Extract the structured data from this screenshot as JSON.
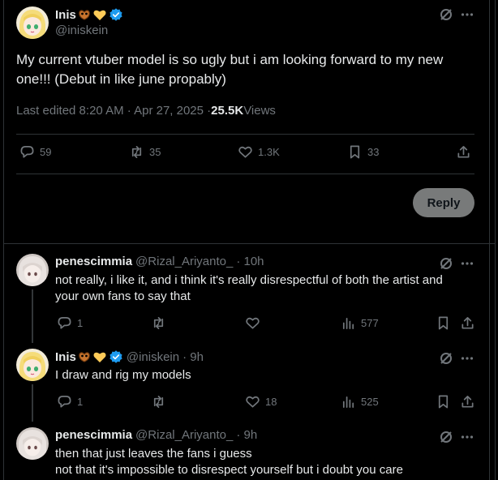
{
  "main_post": {
    "author_name": "Inis",
    "author_handle": "@iniskein",
    "text_line1": "My current vtuber model is so ugly but i am looking forward to my new",
    "text_line2": "one!!! (Debut in like june propably)",
    "meta_prefix": "Last edited 8:20 AM · Apr 27, 2025 · ",
    "views_count": "25.5K",
    "views_label": " Views",
    "replies": "59",
    "reposts": "35",
    "likes": "1.3K",
    "bookmarks": "33",
    "reply_button": "Reply"
  },
  "replies": [
    {
      "author_name": "penescimmia",
      "author_handle": "@Rizal_Ariyanto_",
      "time": "· 10h",
      "line1": "not really, i like it, and i think it's really disrespectful of both the artist and",
      "line2": "your own fans to say that",
      "replies": "1",
      "likes": "",
      "views": "577"
    },
    {
      "author_name": "Inis",
      "author_handle": "@iniskein",
      "time": "· 9h",
      "line1": "I draw and rig my models",
      "replies": "1",
      "likes": "18",
      "views": "525"
    },
    {
      "author_name": "penescimmia",
      "author_handle": "@Rizal_Ariyanto_",
      "time": "· 9h",
      "line1": "then that just leaves the fans i guess",
      "line2": "not that it's impossible to disrespect yourself but i doubt you care"
    }
  ],
  "colors": {
    "background": "#000000",
    "text": "#e7e9ea",
    "muted": "#71767b",
    "verified": "#1d9bf0",
    "reply_button_bg": "#787a7a"
  },
  "icons": [
    "grok-icon",
    "more-icon",
    "reply-icon",
    "repost-icon",
    "like-icon",
    "bookmark-icon",
    "share-icon",
    "views-icon",
    "verified-badge-icon",
    "pretzel-emoji-icon",
    "yellow-heart-emoji-icon"
  ]
}
